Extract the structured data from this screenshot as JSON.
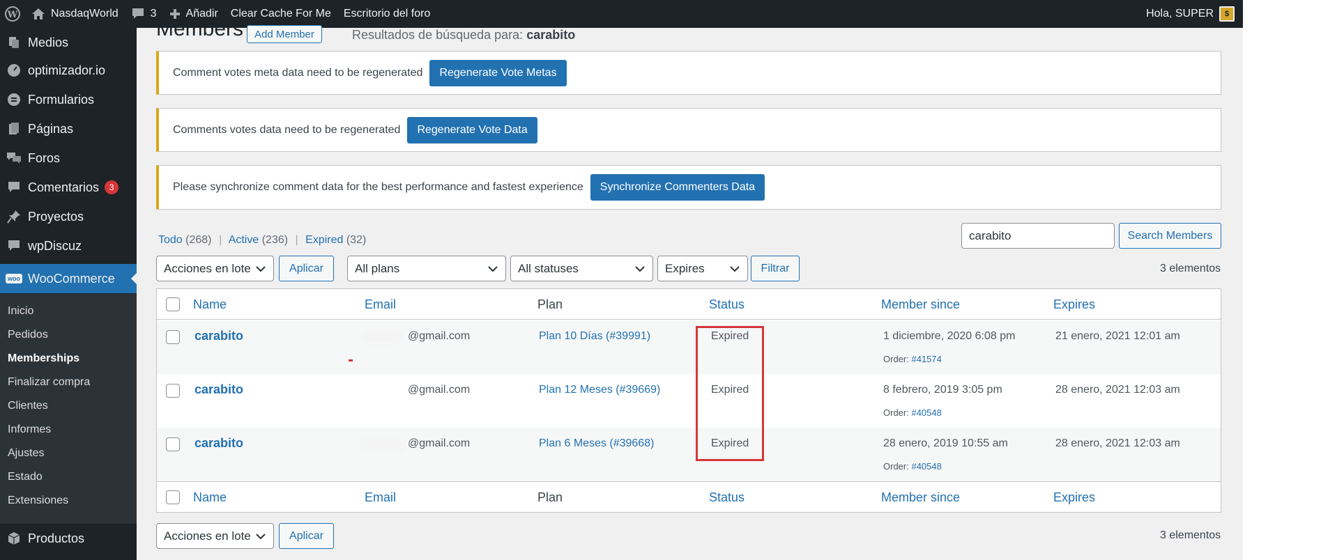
{
  "admin_bar": {
    "site_name": "NasdaqWorld",
    "comments_count": "3",
    "add_label": "Añadir",
    "clear_cache_label": "Clear Cache For Me",
    "forum_desk_label": "Escritorio del foro",
    "greeting": "Hola, SUPER"
  },
  "sidebar": {
    "items": [
      {
        "label": "Medios",
        "icon": "media-icon"
      },
      {
        "label": "optimizador.io",
        "icon": "gauge-icon"
      },
      {
        "label": "Formularios",
        "icon": "forms-icon"
      },
      {
        "label": "Páginas",
        "icon": "pages-icon"
      },
      {
        "label": "Foros",
        "icon": "forums-icon"
      },
      {
        "label": "Comentarios",
        "icon": "comments-icon",
        "badge": "3"
      },
      {
        "label": "Proyectos",
        "icon": "pin-icon"
      },
      {
        "label": "wpDiscuz",
        "icon": "discuz-icon"
      }
    ],
    "woocommerce": {
      "label": "WooCommerce",
      "icon_text": "woo"
    },
    "submenu": [
      "Inicio",
      "Pedidos",
      "Memberships",
      "Finalizar compra",
      "Clientes",
      "Informes",
      "Ajustes",
      "Estado",
      "Extensiones"
    ],
    "submenu_current": "Memberships",
    "productos": "Productos"
  },
  "page": {
    "title": "Members",
    "add_member": "Add Member",
    "search_prefix": "Resultados de búsqueda para:",
    "search_term": "carabito"
  },
  "notices": [
    {
      "text": "Comment votes meta data need to be regenerated",
      "button": "Regenerate Vote Metas"
    },
    {
      "text": "Comments votes data need to be regenerated",
      "button": "Regenerate Vote Data"
    },
    {
      "text": "Please synchronize comment data for the best performance and fastest experience",
      "button": "Synchronize Commenters Data"
    }
  ],
  "views": {
    "all_label": "Todo",
    "all_count": "(268)",
    "active_label": "Active",
    "active_count": "(236)",
    "expired_label": "Expired",
    "expired_count": "(32)",
    "separator": "|"
  },
  "search": {
    "value": "carabito",
    "button": "Search Members"
  },
  "filters": {
    "bulk_action": "Acciones en lote",
    "apply": "Aplicar",
    "plans": "All plans",
    "statuses": "All statuses",
    "expires": "Expires",
    "filter_button": "Filtrar",
    "item_count": "3 elementos"
  },
  "table": {
    "columns": [
      "Name",
      "Email",
      "Plan",
      "Status",
      "Member since",
      "Expires"
    ],
    "order_prefix": "Order:",
    "rows": [
      {
        "name": "carabito",
        "email": "@gmail.com",
        "plan": "Plan 10 Días (#39991)",
        "status": "Expired",
        "member_since": "1 diciembre, 2020 6:08 pm",
        "order": "#41574",
        "expires": "21 enero, 2021 12:01 am"
      },
      {
        "name": "carabito",
        "email": "@gmail.com",
        "plan": "Plan 12 Meses (#39669)",
        "status": "Expired",
        "member_since": "8 febrero, 2019 3:05 pm",
        "order": "#40548",
        "expires": "28 enero, 2021 12:03 am"
      },
      {
        "name": "carabito",
        "email": "@gmail.com",
        "plan": "Plan 6 Meses (#39668)",
        "status": "Expired",
        "member_since": "28 enero, 2019 10:55 am",
        "order": "#40548",
        "expires": "28 enero, 2021 12:03 am"
      }
    ]
  },
  "colors": {
    "admin_bar_bg": "#1d2327",
    "accent": "#2271b1",
    "notice_warning": "#dba617",
    "highlight_red": "#d63638"
  }
}
